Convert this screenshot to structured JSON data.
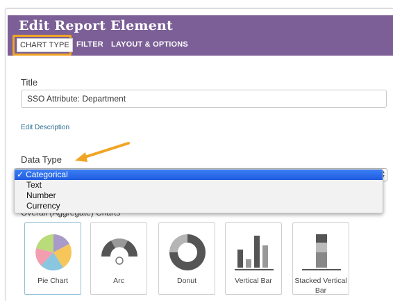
{
  "header": {
    "title": "Edit Report Element",
    "accent_color": "#7b5f96",
    "highlight_color": "#f0a525"
  },
  "tabs": [
    {
      "label": "CHART TYPE",
      "active": true
    },
    {
      "label": "FILTER",
      "active": false
    },
    {
      "label": "LAYOUT & OPTIONS",
      "active": false
    }
  ],
  "title_field": {
    "label": "Title",
    "value": "SSO Attribute: Department"
  },
  "edit_description_link": "Edit Description",
  "data_type": {
    "label": "Data Type",
    "selected": "Categorical",
    "options": [
      {
        "label": "Categorical",
        "selected": true
      },
      {
        "label": "Text",
        "selected": false
      },
      {
        "label": "Number",
        "selected": false
      },
      {
        "label": "Currency",
        "selected": false
      }
    ]
  },
  "charts_section": {
    "heading": "Overall (Aggregate) Charts",
    "items": [
      {
        "label": "Pie Chart",
        "icon": "pie-chart-icon",
        "selected": true
      },
      {
        "label": "Arc",
        "icon": "arc-chart-icon",
        "selected": false
      },
      {
        "label": "Donut",
        "icon": "donut-chart-icon",
        "selected": false
      },
      {
        "label": "Vertical Bar",
        "icon": "vertical-bar-icon",
        "selected": false
      },
      {
        "label": "Stacked Vertical Bar",
        "icon": "stacked-bar-icon",
        "selected": false
      }
    ]
  }
}
